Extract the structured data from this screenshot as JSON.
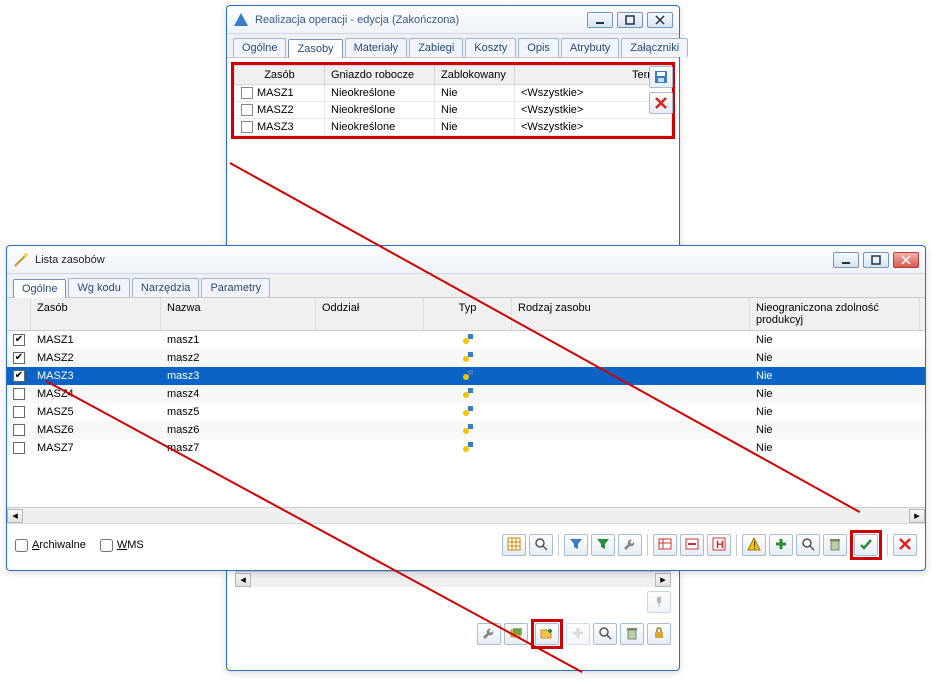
{
  "top_window": {
    "title": "Realizacja operacji - edycja (Zakończona)",
    "tabs": [
      "Ogólne",
      "Zasoby",
      "Materiały",
      "Zabiegi",
      "Koszty",
      "Opis",
      "Atrybuty",
      "Załączniki"
    ],
    "active_tab": 1,
    "columns": {
      "zasob": "Zasób",
      "gniazdo": "Gniazdo robocze",
      "zablok": "Zablokowany",
      "termin": "Termin"
    },
    "rows": [
      {
        "zasob": "MASZ1",
        "gniazdo": "Nieokreślone",
        "zablok": "Nie",
        "termin": "<Wszystkie>"
      },
      {
        "zasob": "MASZ2",
        "gniazdo": "Nieokreślone",
        "zablok": "Nie",
        "termin": "<Wszystkie>"
      },
      {
        "zasob": "MASZ3",
        "gniazdo": "Nieokreślone",
        "zablok": "Nie",
        "termin": "<Wszystkie>"
      }
    ],
    "side_icons": {
      "save": "floppy-icon",
      "delete": "red-x-icon"
    },
    "bottom_icons": [
      "wrench-icon",
      "folder-copy-icon",
      "folder-new-icon",
      "plus-disabled-icon",
      "magnifier-icon",
      "trash-icon",
      "lock-icon"
    ],
    "bottom_extra_icon": "pin-icon"
  },
  "list_window": {
    "title": "Lista zasobów",
    "tabs": [
      "Ogólne",
      "Wg kodu",
      "Narzędzia",
      "Parametry"
    ],
    "active_tab": 0,
    "columns": {
      "zasob": "Zasób",
      "nazwa": "Nazwa",
      "oddzial": "Oddział",
      "typ": "Typ",
      "rodzaj": "Rodzaj zasobu",
      "nieorg": "Nieograniczona zdolność produkcyj"
    },
    "items": [
      {
        "checked": true,
        "zasob": "MASZ1",
        "nazwa": "masz1",
        "nieorg": "Nie",
        "selected": false
      },
      {
        "checked": true,
        "zasob": "MASZ2",
        "nazwa": "masz2",
        "nieorg": "Nie",
        "selected": false
      },
      {
        "checked": true,
        "zasob": "MASZ3",
        "nazwa": "masz3",
        "nieorg": "Nie",
        "selected": true
      },
      {
        "checked": false,
        "zasob": "MASZ4",
        "nazwa": "masz4",
        "nieorg": "Nie",
        "selected": false
      },
      {
        "checked": false,
        "zasob": "MASZ5",
        "nazwa": "masz5",
        "nieorg": "Nie",
        "selected": false
      },
      {
        "checked": false,
        "zasob": "MASZ6",
        "nazwa": "masz6",
        "nieorg": "Nie",
        "selected": false
      },
      {
        "checked": false,
        "zasob": "MASZ7",
        "nazwa": "masz7",
        "nieorg": "Nie",
        "selected": false
      }
    ],
    "footer": {
      "archiwalne_label": "Archiwalne",
      "archiwalne_accel": "A",
      "wms_label": "WMS",
      "wms_accel": "W"
    },
    "toolbar_icons": [
      "grid-icon",
      "magnifier-icon",
      "funnel-blue-icon",
      "funnel-excel-icon",
      "wrench-icon",
      "table-red-icon",
      "table-minus-icon",
      "h-icon",
      "warning-icon",
      "plus-icon",
      "magnifier-icon",
      "trash-icon",
      "check-icon",
      "red-x-icon"
    ]
  }
}
